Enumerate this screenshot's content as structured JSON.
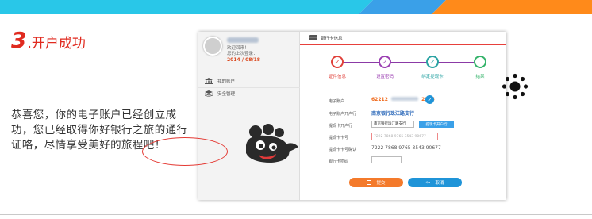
{
  "step": {
    "number": "3",
    "title": ".开户成功"
  },
  "description": "恭喜您，你的电子账户已经创立成功，您已经取得你好银行之旅的通行证咯，尽情享受美好的旅程吧！",
  "screenshot": {
    "user": {
      "welcome_line1": "欢迎回来！",
      "welcome_line2": "您的上次登录：",
      "date": "2014 / 08/18"
    },
    "menu": [
      {
        "label": "我的账户",
        "icon": "bank-icon"
      },
      {
        "label": "安全管理",
        "icon": "layers-icon"
      }
    ],
    "header": {
      "title": "银行卡信息",
      "icon": "card-icon"
    },
    "steps": [
      {
        "label": "证件信息",
        "color": "#e0403a"
      },
      {
        "label": "设置密码",
        "color": "#9b3fb2"
      },
      {
        "label": "绑定提现卡",
        "color": "#2aa3a3"
      },
      {
        "label": "结果",
        "color": "#34b36a"
      }
    ],
    "fields": {
      "account_label": "电子账户",
      "account_value_a": "62212",
      "account_value_b": "2345",
      "bank_label": "电子账户开户行",
      "bank_value": "南京银行珠江路支行",
      "card_bank_label": "提现卡开户行",
      "card_bank_value": "南京银行珠江路支行",
      "card_bank_button": "提现卡开户行",
      "card_no_label": "提现卡卡号",
      "card_no_value": "7222 7868 9765 3543 90677",
      "card_no_confirm_label": "提现卡卡号确认",
      "card_no_confirm_value": "7222 7868 9765 3543 90677",
      "card_pwd_label": "银行卡密码"
    },
    "buttons": {
      "submit": "提交",
      "cancel": "取消"
    }
  },
  "colors": {
    "accent": "#e02a1f",
    "submit": "#f47a2b",
    "cancel": "#1f94d8"
  }
}
